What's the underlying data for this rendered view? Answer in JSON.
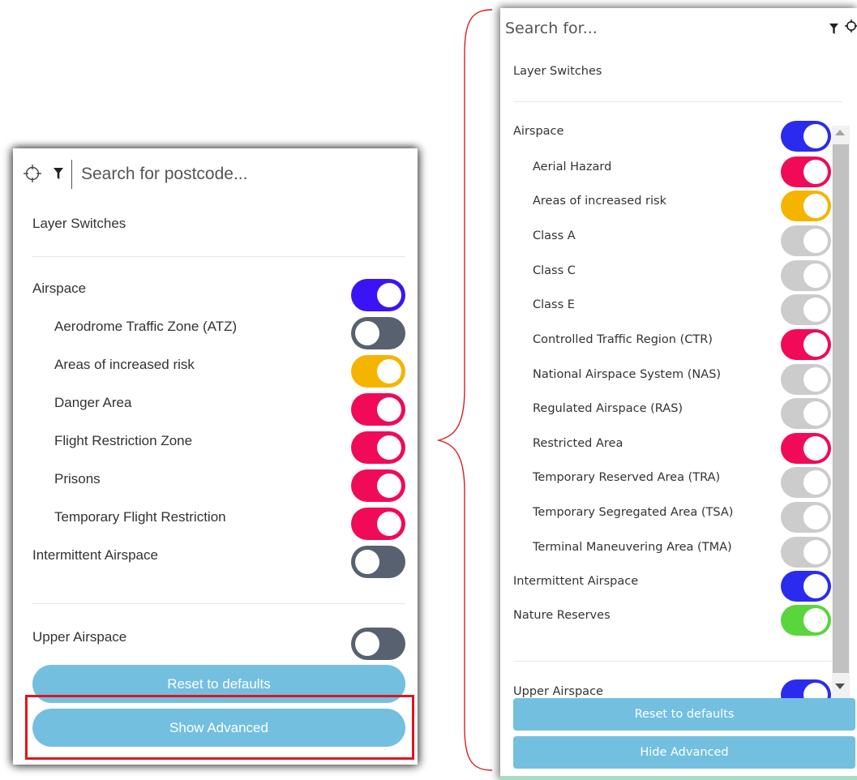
{
  "left_panel": {
    "search_placeholder": "Search for postcode...",
    "layer_switches_title": "Layer Switches",
    "items": [
      {
        "label": "Airspace",
        "state": "on",
        "color": "#3a14f5"
      },
      {
        "label": "Aerodrome Traffic Zone (ATZ)",
        "state": "off",
        "color": "#586170"
      },
      {
        "label": "Areas of increased risk",
        "state": "on",
        "color": "#f4b400"
      },
      {
        "label": "Danger Area",
        "state": "on",
        "color": "#f00a58"
      },
      {
        "label": "Flight Restriction Zone",
        "state": "on",
        "color": "#f00a58"
      },
      {
        "label": "Prisons",
        "state": "on",
        "color": "#f00a58"
      },
      {
        "label": "Temporary Flight Restriction",
        "state": "on",
        "color": "#f00a58"
      },
      {
        "label": "Intermittent Airspace",
        "state": "off",
        "color": "#586170"
      }
    ],
    "upper_airspace": {
      "label": "Upper Airspace",
      "state": "off",
      "color": "#586170"
    },
    "reset_label": "Reset to defaults",
    "advanced_label": "Show Advanced"
  },
  "right_panel": {
    "search_placeholder": "Search for...",
    "layer_switches_title": "Layer Switches",
    "items": [
      {
        "label": "Airspace",
        "state": "on",
        "color": "#2b2bf0"
      },
      {
        "label": "Aerial Hazard",
        "state": "on",
        "color": "#f00a58"
      },
      {
        "label": "Areas of increased risk",
        "state": "on",
        "color": "#f4b400"
      },
      {
        "label": "Class A",
        "state": "on",
        "color": "#cccccc"
      },
      {
        "label": "Class C",
        "state": "on",
        "color": "#cccccc"
      },
      {
        "label": "Class E",
        "state": "on",
        "color": "#cccccc"
      },
      {
        "label": "Controlled Traffic Region (CTR)",
        "state": "on",
        "color": "#f00a58"
      },
      {
        "label": "National Airspace System (NAS)",
        "state": "on",
        "color": "#cccccc"
      },
      {
        "label": "Regulated Airspace (RAS)",
        "state": "on",
        "color": "#cccccc"
      },
      {
        "label": "Restricted Area",
        "state": "on",
        "color": "#f00a58"
      },
      {
        "label": "Temporary Reserved Area (TRA)",
        "state": "on",
        "color": "#cccccc"
      },
      {
        "label": "Temporary Segregated Area (TSA)",
        "state": "on",
        "color": "#cccccc"
      },
      {
        "label": "Terminal Maneuvering Area (TMA)",
        "state": "on",
        "color": "#cccccc"
      },
      {
        "label": "Intermittent Airspace",
        "state": "on",
        "color": "#2b2bf0"
      },
      {
        "label": "Nature Reserves",
        "state": "on",
        "color": "#58d63c"
      }
    ],
    "upper_airspace": {
      "label": "Upper Airspace",
      "state": "on",
      "color": "#2b2bf0"
    },
    "reset_label": "Reset to defaults",
    "advanced_label": "Hide Advanced"
  }
}
